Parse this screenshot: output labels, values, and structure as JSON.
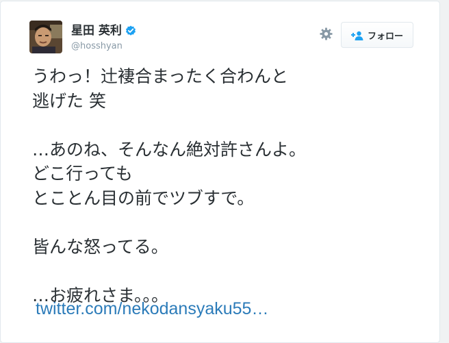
{
  "user": {
    "display_name": "星田 英利",
    "screen_name": "@hosshyan",
    "verified": true
  },
  "actions": {
    "follow_label": "フォロー",
    "settings_icon": "gear-icon",
    "follow_icon": "add-user-icon"
  },
  "tweet": {
    "lines": [
      "うわっ！辻褄合まったく合わんと",
      "逃げた 笑",
      "",
      "…あのね、そんなん絶対許さんよ。",
      "どこ行っても",
      "とことん目の前でツブすで。",
      "",
      "皆んな怒ってる。",
      "",
      "…お疲れさま。。。"
    ],
    "link_text": "twitter.com/nekodansyaku55…"
  },
  "colors": {
    "text": "#292f33",
    "muted": "#8899a6",
    "link": "#2b7bb9",
    "verified": "#1da1f2",
    "border": "#e1e8ed"
  }
}
